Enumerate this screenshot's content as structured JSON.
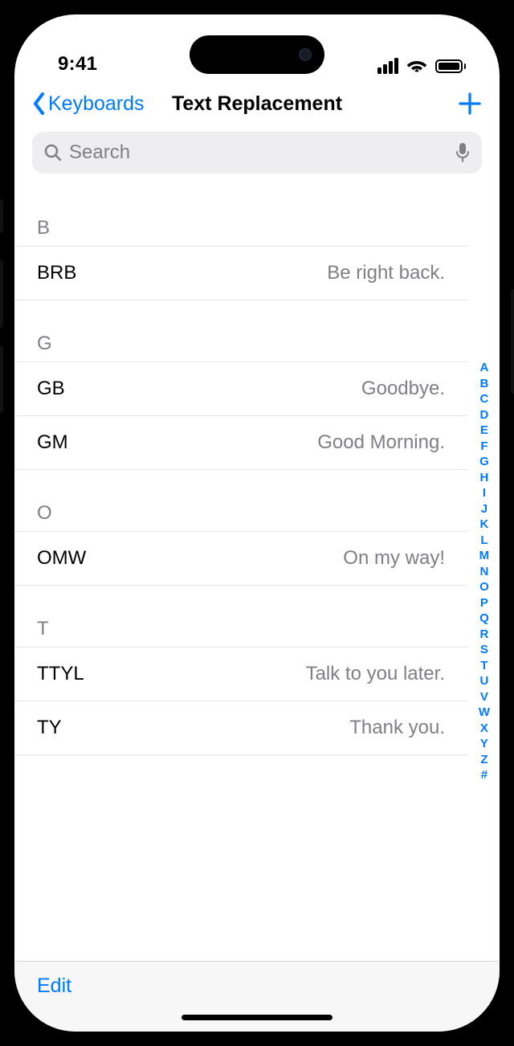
{
  "status": {
    "time": "9:41"
  },
  "nav": {
    "back_label": "Keyboards",
    "title": "Text Replacement"
  },
  "search": {
    "placeholder": "Search"
  },
  "sections": [
    {
      "header": "B",
      "items": [
        {
          "shortcut": "BRB",
          "phrase": "Be right back."
        }
      ]
    },
    {
      "header": "G",
      "items": [
        {
          "shortcut": "GB",
          "phrase": "Goodbye."
        },
        {
          "shortcut": "GM",
          "phrase": "Good Morning."
        }
      ]
    },
    {
      "header": "O",
      "items": [
        {
          "shortcut": "OMW",
          "phrase": "On my way!"
        }
      ]
    },
    {
      "header": "T",
      "items": [
        {
          "shortcut": "TTYL",
          "phrase": "Talk to you later."
        },
        {
          "shortcut": "TY",
          "phrase": "Thank you."
        }
      ]
    }
  ],
  "index_rail": [
    "A",
    "B",
    "C",
    "D",
    "E",
    "F",
    "G",
    "H",
    "I",
    "J",
    "K",
    "L",
    "M",
    "N",
    "O",
    "P",
    "Q",
    "R",
    "S",
    "T",
    "U",
    "V",
    "W",
    "X",
    "Y",
    "Z",
    "#"
  ],
  "toolbar": {
    "edit_label": "Edit"
  }
}
